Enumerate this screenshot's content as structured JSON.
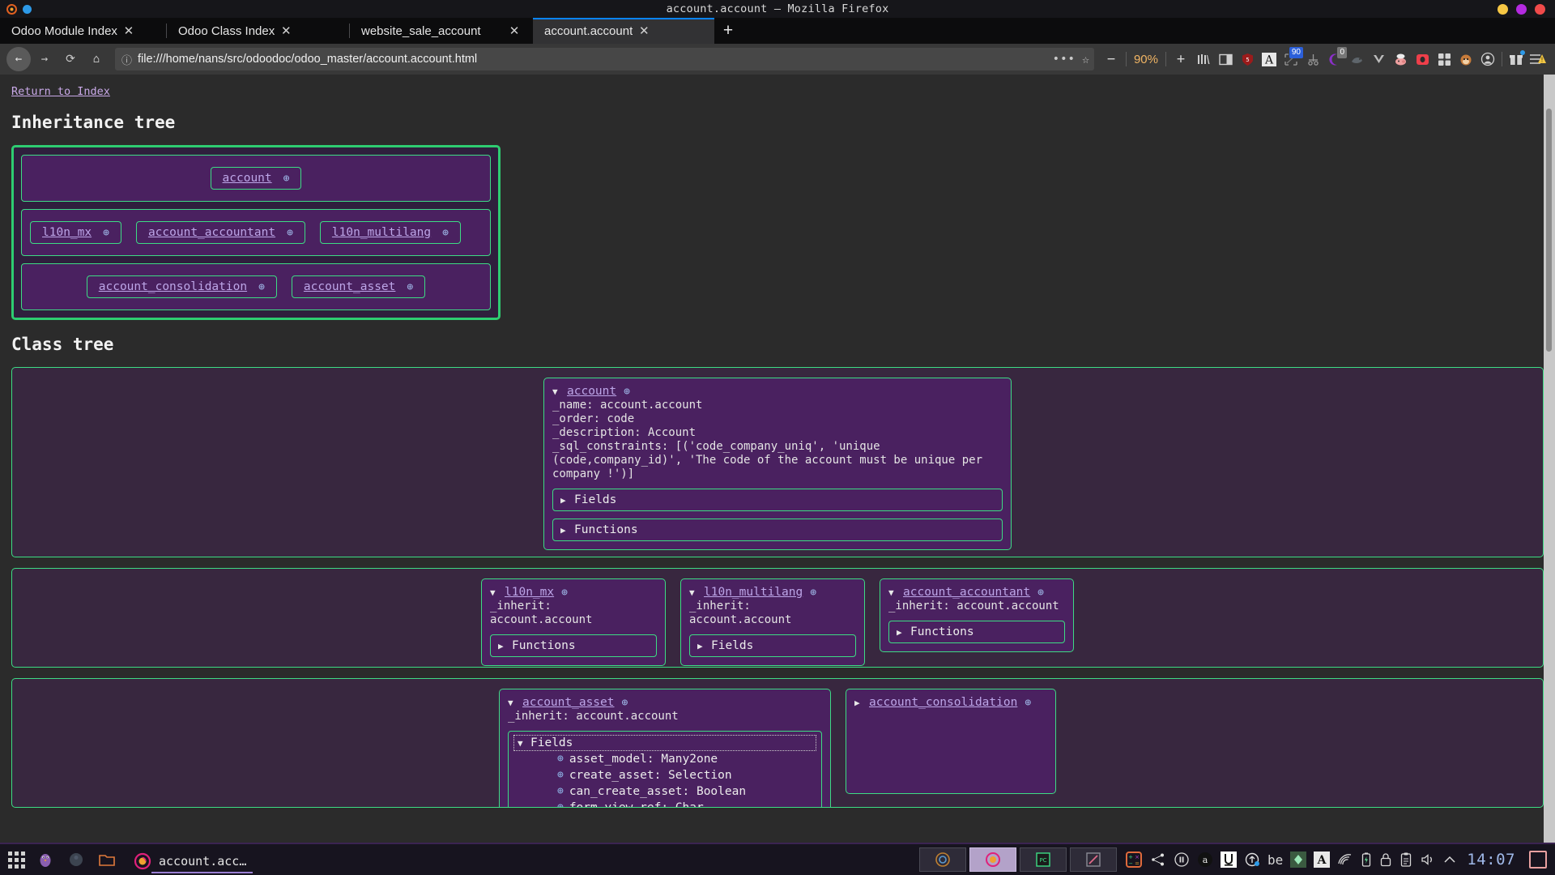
{
  "window": {
    "title": "account.account – Mozilla Firefox",
    "dots": [
      "#f7c744",
      "#b42ae0",
      "#f04a4a"
    ]
  },
  "tabs": [
    {
      "label": "Odoo Module Index",
      "close": "✕",
      "active": false
    },
    {
      "label": "Odoo Class Index",
      "close": "✕",
      "active": false
    },
    {
      "label": "website_sale_account",
      "close": "✕",
      "active": false
    },
    {
      "label": "account.account",
      "close": "✕",
      "active": true
    }
  ],
  "newtab_label": "+",
  "nav": {
    "back_icon": "←",
    "forward_icon": "→",
    "reload_icon": "⟳",
    "home_icon": "⌂",
    "info_icon": "ⓘ",
    "url": "file:///home/nans/src/odoodoc/odoo_master/account.account.html",
    "dots_icon": "•••",
    "star_icon": "☆",
    "zoom_out": "−",
    "zoom_level": "90%",
    "zoom_in": "+",
    "library_icon": "||\\",
    "sidebar_icon": "▤",
    "shield_badge": "5",
    "reader_icon": "A",
    "screenshot_badge": "90",
    "cut_icon": "✂",
    "moon_badge": "0",
    "menu_icon": "☰",
    "warning_icon": "⚠",
    "save_icon": "↓"
  },
  "page": {
    "return_link": "Return to Index",
    "inheritance_heading": "Inheritance tree",
    "class_heading": "Class tree",
    "globe_icon": "⊕",
    "caret_open": "▼",
    "caret_closed": "▶"
  },
  "inheritance_tree": {
    "rows": [
      {
        "align": "center",
        "nodes": [
          {
            "label": "account"
          }
        ]
      },
      {
        "align": "left",
        "nodes": [
          {
            "label": "l10n_mx"
          },
          {
            "label": "account_accountant"
          },
          {
            "label": "l10n_multilang"
          }
        ]
      },
      {
        "align": "center",
        "nodes": [
          {
            "label": "account_consolidation"
          },
          {
            "label": "account_asset"
          }
        ]
      }
    ]
  },
  "class_tree": {
    "row1": [
      {
        "name": "account",
        "expanded": true,
        "meta": "_name: account.account\n_order: code\n_description: Account\n_sql_constraints: [('code_company_uniq', 'unique\n(code,company_id)', 'The code of the account must be unique per\ncompany !')]",
        "sections": [
          {
            "label": "Fields",
            "open": false
          },
          {
            "label": "Functions",
            "open": false
          }
        ]
      }
    ],
    "row2": [
      {
        "name": "l10n_mx",
        "expanded": true,
        "meta": "_inherit: account.account",
        "sections": [
          {
            "label": "Functions",
            "open": false
          }
        ]
      },
      {
        "name": "l10n_multilang",
        "expanded": true,
        "meta": "_inherit: account.account",
        "sections": [
          {
            "label": "Fields",
            "open": false
          }
        ]
      },
      {
        "name": "account_accountant",
        "expanded": true,
        "meta": "_inherit: account.account",
        "sections": [
          {
            "label": "Functions",
            "open": false
          }
        ]
      }
    ],
    "row3": [
      {
        "name": "account_asset",
        "expanded": true,
        "meta": "_inherit: account.account",
        "sections": [
          {
            "label": "Fields",
            "open": true,
            "fields": [
              "asset_model: Many2one",
              "create_asset: Selection",
              "can_create_asset: Boolean",
              "form_view_ref: Char"
            ]
          }
        ]
      },
      {
        "name": "account_consolidation",
        "expanded": false,
        "meta": "",
        "sections": []
      }
    ]
  },
  "taskbar": {
    "window_title": "account.acc…",
    "clock": "14:07",
    "tray": [
      "be",
      "A",
      "wifi-icon",
      "battery-icon",
      "lock-icon",
      "clipboard-icon",
      "volume-icon",
      "chevron-up-icon"
    ]
  }
}
